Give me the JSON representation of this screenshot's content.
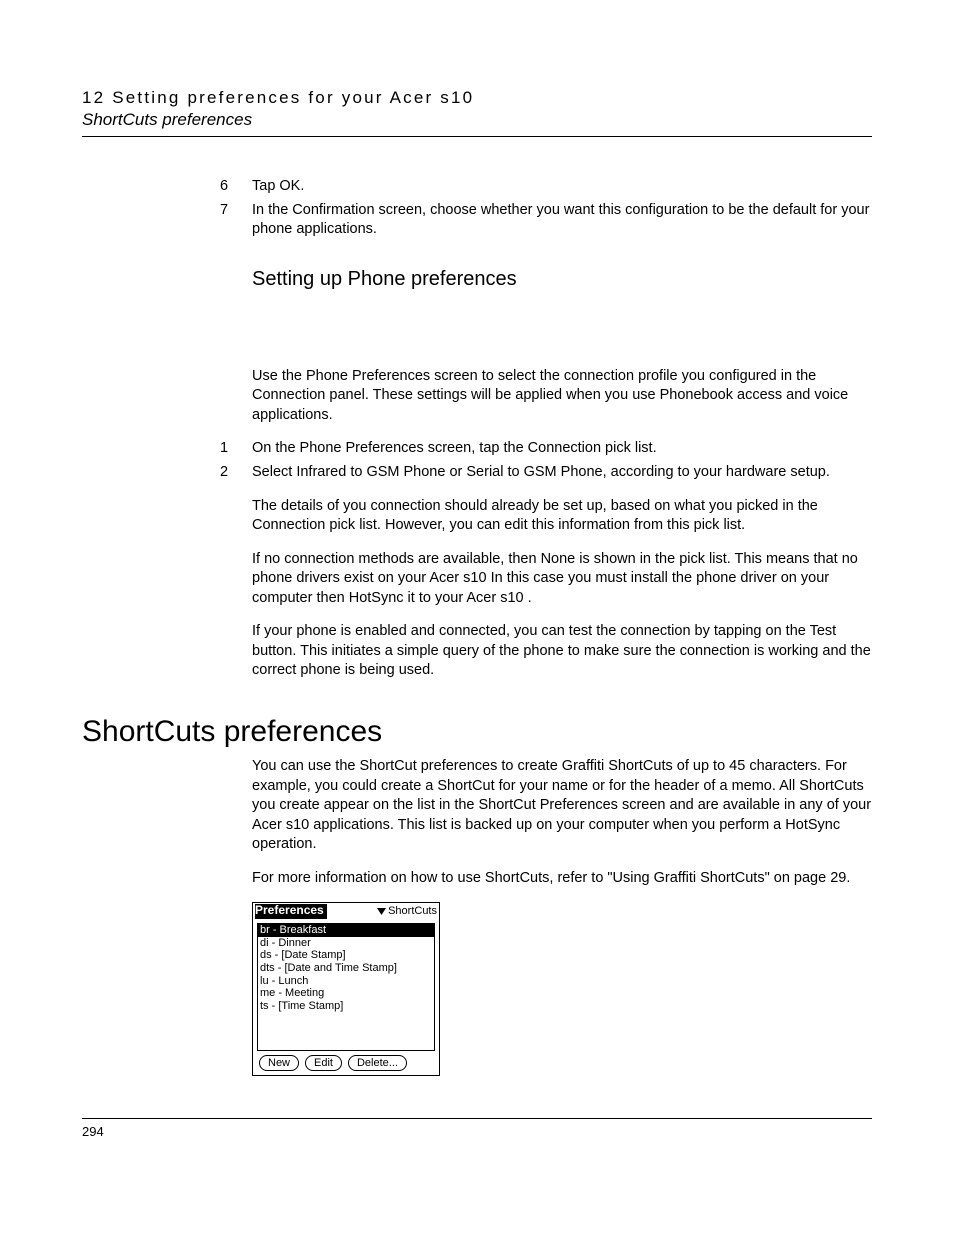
{
  "header": {
    "chapter": "12 Setting preferences for your Acer s10",
    "section": "ShortCuts preferences"
  },
  "steps_a": [
    {
      "num": "6",
      "text": "Tap OK."
    },
    {
      "num": "7",
      "text": "In the Confirmation screen, choose whether you want this configuration to be the default for your phone applications."
    }
  ],
  "sub_heading": "Setting up Phone preferences",
  "intro_para": "Use the Phone Preferences screen to select the connection profile you configured in the Connection panel. These settings will be applied when you use Phonebook access and voice applications.",
  "steps_b": [
    {
      "num": "1",
      "text": "On the Phone Preferences screen, tap the Connection pick list."
    },
    {
      "num": "2",
      "text": "Select Infrared to GSM Phone or Serial to GSM Phone, according to your hardware setup."
    }
  ],
  "paras_b": [
    "The details of you connection should already be set up, based on what you picked in the Connection pick list. However, you can edit this information from this pick list.",
    "If no connection methods are available, then None is shown in the pick list. This means that no phone drivers exist on your Acer s10  In this case you must install the phone driver on your computer then HotSync it to your Acer s10 .",
    "If your phone is enabled and connected, you can test the connection by tapping on the Test button. This initiates a simple query of the phone to make sure the connection is working and the correct phone is being used."
  ],
  "main_heading": "ShortCuts preferences",
  "paras_c": [
    "You can use the ShortCut preferences to create Graffiti ShortCuts of up to 45 characters. For example, you could create a ShortCut for your name or for the header of a memo. All ShortCuts you create appear on the list in the ShortCut Preferences screen and are available in any of your Acer s10 applications. This list is backed up on your computer when you perform a HotSync operation.",
    "For more information on how to use ShortCuts, refer to \"Using Graffiti ShortCuts\" on page 29."
  ],
  "palm": {
    "title": "Preferences",
    "dropdown": "ShortCuts",
    "items": [
      "br - Breakfast",
      "di - Dinner",
      "ds - [Date Stamp]",
      "dts - [Date and Time Stamp]",
      "lu - Lunch",
      "me - Meeting",
      "ts - [Time Stamp]"
    ],
    "buttons": {
      "new": "New",
      "edit": "Edit",
      "delete": "Delete..."
    }
  },
  "page_number": "294"
}
